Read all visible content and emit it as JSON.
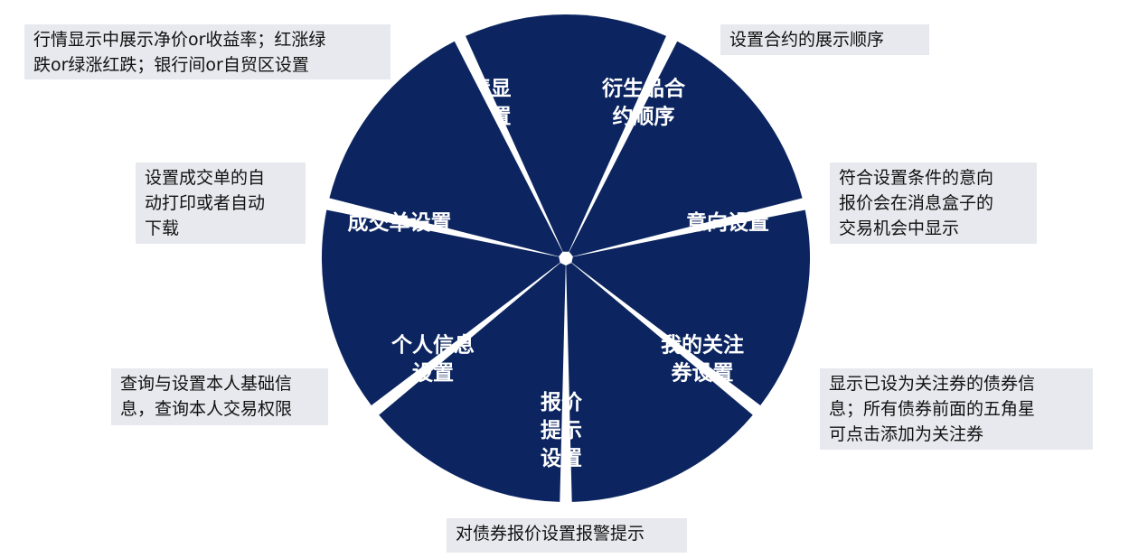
{
  "colors": {
    "segment": "#0c2560",
    "note_bg": "#e7e9ee",
    "label": "#ffffff"
  },
  "segments": [
    {
      "id": "hangqing",
      "label": "行情显\n示设置"
    },
    {
      "id": "yansheng",
      "label": "衍生品合\n约顺序"
    },
    {
      "id": "yixiang",
      "label": "意向设置"
    },
    {
      "id": "guanzhu",
      "label": "我的关注\n券设置"
    },
    {
      "id": "baojia",
      "label": "报价\n提示\n设置"
    },
    {
      "id": "geren",
      "label": "个人信息\n设置"
    },
    {
      "id": "chengjiao",
      "label": "成交单设置"
    }
  ],
  "notes": [
    {
      "id": "hangqing",
      "text": "行情显示中展示净价or收益率；红涨绿\n跌or绿涨红跌；银行间or自贸区设置"
    },
    {
      "id": "yansheng",
      "text": "设置合约的展示顺序"
    },
    {
      "id": "chengjiao",
      "text": "设置成交单的自\n动打印或者自动\n下载"
    },
    {
      "id": "yixiang",
      "text": "符合设置条件的意向\n报价会在消息盒子的\n交易机会中显示"
    },
    {
      "id": "geren",
      "text": "查询与设置本人基础信\n息，查询本人交易权限"
    },
    {
      "id": "guanzhu",
      "text": "显示已设为关注券的债券信\n息；所有债券前面的五角星\n可点击添加为关注券"
    },
    {
      "id": "baojia",
      "text": "对债券报价设置报警提示"
    }
  ]
}
